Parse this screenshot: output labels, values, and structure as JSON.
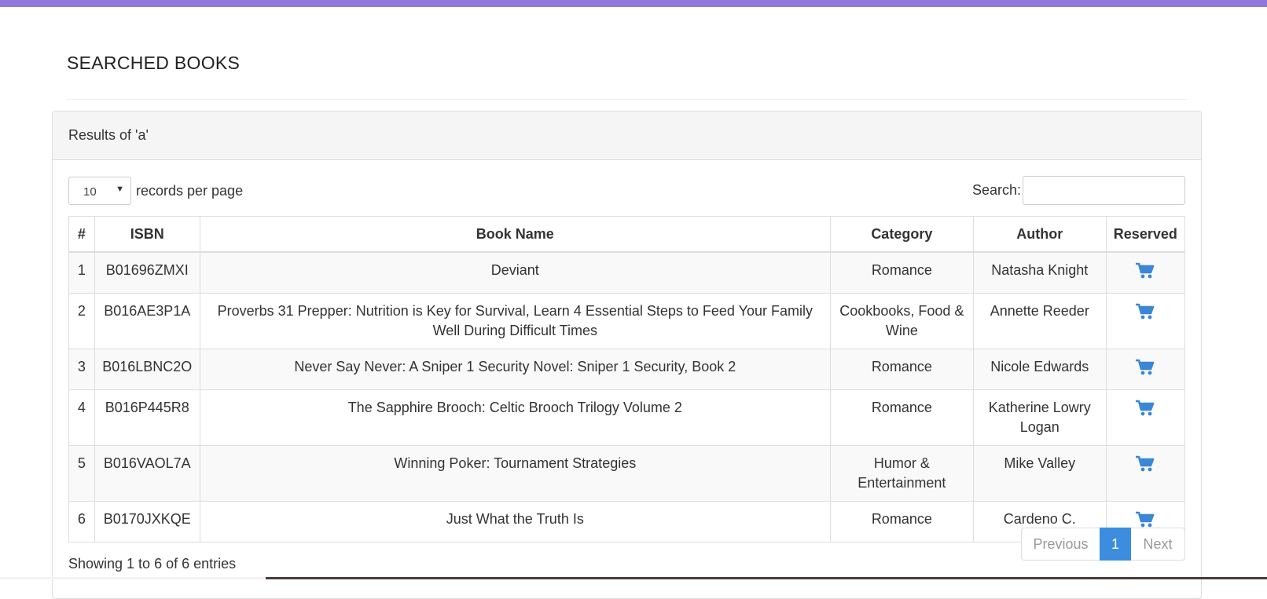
{
  "page": {
    "title": "SEARCHED BOOKS"
  },
  "panel": {
    "heading": "Results of 'a'"
  },
  "length_control": {
    "selected": "10",
    "suffix": "records per page"
  },
  "search": {
    "label": "Search:",
    "value": ""
  },
  "table": {
    "columns": [
      "#",
      "ISBN",
      "Book Name",
      "Category",
      "Author",
      "Reserved"
    ],
    "rows": [
      {
        "num": "1",
        "isbn": "B01696ZMXI",
        "name": "Deviant",
        "category": "Romance",
        "author": "Natasha Knight",
        "reserved_icon": "cart-icon"
      },
      {
        "num": "2",
        "isbn": "B016AE3P1A",
        "name": "Proverbs 31 Prepper: Nutrition is Key for Survival, Learn 4 Essential Steps to Feed Your Family Well During Difficult Times",
        "category": "Cookbooks, Food & Wine",
        "author": "Annette Reeder",
        "reserved_icon": "cart-icon"
      },
      {
        "num": "3",
        "isbn": "B016LBNC2O",
        "name": "Never Say Never: A Sniper 1 Security Novel: Sniper 1 Security, Book 2",
        "category": "Romance",
        "author": "Nicole Edwards",
        "reserved_icon": "cart-icon"
      },
      {
        "num": "4",
        "isbn": "B016P445R8",
        "name": "The Sapphire Brooch: Celtic Brooch Trilogy Volume 2",
        "category": "Romance",
        "author": "Katherine Lowry Logan",
        "reserved_icon": "cart-icon"
      },
      {
        "num": "5",
        "isbn": "B016VAOL7A",
        "name": "Winning Poker: Tournament Strategies",
        "category": "Humor & Entertainment",
        "author": "Mike Valley",
        "reserved_icon": "cart-icon"
      },
      {
        "num": "6",
        "isbn": "B0170JXKQE",
        "name": "Just What the Truth Is",
        "category": "Romance",
        "author": "Cardeno C.",
        "reserved_icon": "cart-icon"
      }
    ]
  },
  "footer": {
    "info": "Showing 1 to 6 of 6 entries"
  },
  "pagination": {
    "previous": "Previous",
    "current": "1",
    "next": "Next"
  },
  "colors": {
    "accent_bar": "#9177d9",
    "primary": "#3c8dde",
    "cart_icon": "#3a87d6"
  }
}
